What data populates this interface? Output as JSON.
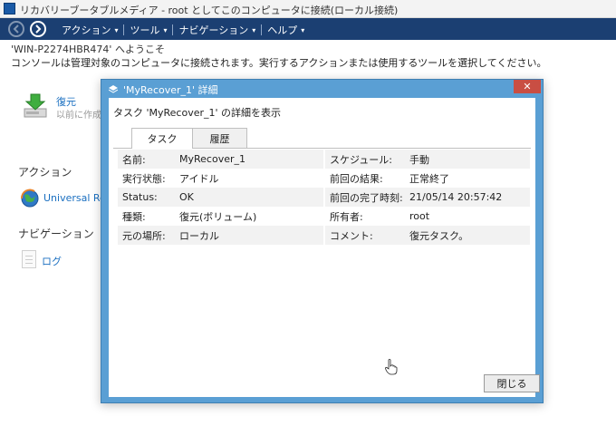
{
  "window": {
    "title": "リカバリーブータブルメディア - root としてこのコンピュータに接続(ローカル接続)"
  },
  "menu": {
    "items": [
      {
        "label": "アクション"
      },
      {
        "label": "ツール"
      },
      {
        "label": "ナビゲーション"
      },
      {
        "label": "ヘルプ"
      }
    ]
  },
  "main": {
    "welcome": "'WIN-P2274HBR474' へようこそ",
    "console_message": "コンソールは管理対象のコンピュータに接続されます。実行するアクションまたは使用するツールを選択してください。",
    "restore": {
      "title": "復元",
      "desc": "以前に作成"
    },
    "actions_heading": "アクション",
    "universal_link": "Universal Re",
    "navigation_heading": "ナビゲーション",
    "log_link": "ログ"
  },
  "dialog": {
    "title": "'MyRecover_1' 詳細",
    "close_glyph": "✕",
    "heading": "タスク 'MyRecover_1' の詳細を表示",
    "tabs": [
      {
        "label": "タスク"
      },
      {
        "label": "履歴"
      }
    ],
    "rows": [
      {
        "l1": "名前:",
        "v1": "MyRecover_1",
        "l2": "スケジュール:",
        "v2": "手動"
      },
      {
        "l1": "実行状態:",
        "v1": "アイドル",
        "l2": "前回の結果:",
        "v2": "正常終了"
      },
      {
        "l1": "Status:",
        "v1": "OK",
        "l2": "前回の完了時刻:",
        "v2": "21/05/14 20:57:42"
      },
      {
        "l1": "種類:",
        "v1": "復元(ボリューム)",
        "l2": "所有者:",
        "v2": "root"
      },
      {
        "l1": "元の場所:",
        "v1": "ローカル",
        "l2": "コメント:",
        "v2": "復元タスク。"
      }
    ],
    "close_button": "閉じる"
  },
  "colors": {
    "menu_bar": "#1b3f72",
    "dialog_frame": "#5a9fd4",
    "link": "#1a6fc0",
    "close_red": "#c94e43"
  }
}
